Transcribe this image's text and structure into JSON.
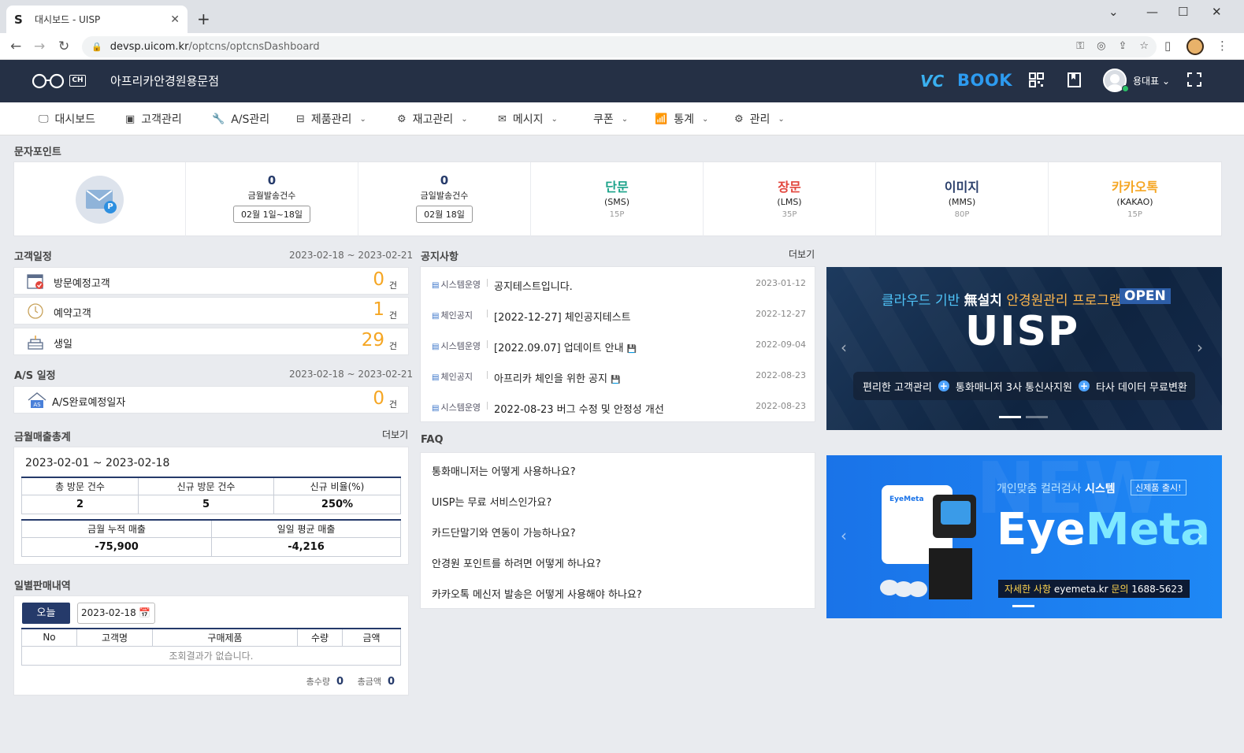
{
  "browser": {
    "tab_title": "대시보드 - UISP",
    "tab_favicon": "S",
    "url_host": "devsp.uicom.kr",
    "url_path": "/optcns/optcnsDashboard"
  },
  "header": {
    "store_name": "아프리카안경원용문점",
    "logo_badge": "CH",
    "vc_label": "VC",
    "book_label": "BOOK",
    "username": "용대표"
  },
  "menu": [
    {
      "label": "대시보드",
      "icon": "monitor-icon"
    },
    {
      "label": "고객관리",
      "icon": "contacts-icon"
    },
    {
      "label": "A/S관리",
      "icon": "wrench-icon"
    },
    {
      "label": "제품관리",
      "icon": "box-icon"
    },
    {
      "label": "재고관리",
      "icon": "gear-icon"
    },
    {
      "label": "메시지",
      "icon": "mail-icon"
    },
    {
      "label": "쿠폰",
      "icon": "coupon-icon"
    },
    {
      "label": "통계",
      "icon": "chart-icon"
    },
    {
      "label": "관리",
      "icon": "gear-icon"
    }
  ],
  "sms": {
    "section_label": "문자포인트",
    "month": {
      "count": "0",
      "label": "금월발송건수",
      "range": "02월 1일~18일"
    },
    "today": {
      "count": "0",
      "label": "금일발송건수",
      "range": "02월 18일"
    },
    "types": [
      {
        "title": "단문",
        "sub": "(SMS)",
        "pt": "15P",
        "color": "#1ba38a"
      },
      {
        "title": "장문",
        "sub": "(LMS)",
        "pt": "35P",
        "color": "#e2453c"
      },
      {
        "title": "이미지",
        "sub": "(MMS)",
        "pt": "80P",
        "color": "#2b3f6b"
      },
      {
        "title": "카카오톡",
        "sub": "(KAKAO)",
        "pt": "15P",
        "color": "#f5a623"
      }
    ]
  },
  "customer_schedule": {
    "label": "고객일정",
    "date_range": "2023-02-18 ~ 2023-02-21",
    "rows": [
      {
        "label": "방문예정고객",
        "count": "0",
        "unit": "건"
      },
      {
        "label": "예약고객",
        "count": "1",
        "unit": "건"
      },
      {
        "label": "생일",
        "count": "29",
        "unit": "건"
      }
    ]
  },
  "as_schedule": {
    "label": "A/S 일정",
    "date_range": "2023-02-18 ~ 2023-02-21",
    "rows": [
      {
        "label": "A/S완료예정일자",
        "count": "0",
        "unit": "건",
        "icon_text": "AS"
      }
    ]
  },
  "monthly_sales": {
    "label": "금월매출총계",
    "more": "더보기",
    "range": "2023-02-01 ~ 2023-02-18",
    "headers1": [
      "총 방문 건수",
      "신규 방문 건수",
      "신규 비율(%)"
    ],
    "values1": [
      "2",
      "5",
      "250%"
    ],
    "headers2": [
      "금월 누적 매출",
      "일일 평균 매출"
    ],
    "values2": [
      "-75,900",
      "-4,216"
    ]
  },
  "daily_sales": {
    "label": "일별판매내역",
    "today_btn": "오늘",
    "date": "2023-02-18",
    "headers": [
      "No",
      "고객명",
      "구매제품",
      "수량",
      "금액"
    ],
    "empty": "조회결과가 없습니다.",
    "total_qty_label": "총수량",
    "total_qty": "0",
    "total_amt_label": "총금액",
    "total_amt": "0"
  },
  "notices": {
    "label": "공지사항",
    "more": "더보기",
    "items": [
      {
        "cat": "시스템운영",
        "title": "공지테스트입니다.",
        "date": "2023-01-12",
        "attach": false
      },
      {
        "cat": "체인공지",
        "title": "[2022-12-27] 체인공지테스트",
        "date": "2022-12-27",
        "attach": false
      },
      {
        "cat": "시스템운영",
        "title": "[2022.09.07] 업데이트 안내",
        "date": "2022-09-04",
        "attach": true
      },
      {
        "cat": "체인공지",
        "title": "아프리카 체인을 위한 공지",
        "date": "2022-08-23",
        "attach": true
      },
      {
        "cat": "시스템운영",
        "title": "2022-08-23 버그 수정 및 안정성 개선",
        "date": "2022-08-23",
        "attach": false
      }
    ]
  },
  "faq": {
    "label": "FAQ",
    "items": [
      "통화매니저는 어떻게 사용하나요?",
      "UISP는 무료 서비스인가요?",
      "카드단말기와 연동이 가능하나요?",
      "안경원 포인트를 하려면 어떻게 하나요?",
      "카카오톡 메신저 발송은 어떻게 사용해야 하나요?"
    ]
  },
  "banner_uisp": {
    "head_a": "클라우드 기반 ",
    "head_b": "無설치",
    "head_c": " 안경원관리 프로그램",
    "open": "OPEN",
    "logo": "UISP",
    "feature1": "편리한 고객관리",
    "feature2": "통화매니저 3사 통신사지원",
    "feature3": "타사 데이터 무료변환"
  },
  "banner_eyemeta": {
    "bg_text": "NEW",
    "head_a": "개인맞춤 컬러검사 ",
    "head_b": "시스템",
    "badge": "신제품 출시!",
    "logo_a": "Eye",
    "logo_b": "Meta",
    "info_a": "자세한 사항 ",
    "info_b": "eyemeta.kr",
    "info_c": "   문의 ",
    "info_d": "1688-5623",
    "device_brand": "EyeMeta"
  }
}
